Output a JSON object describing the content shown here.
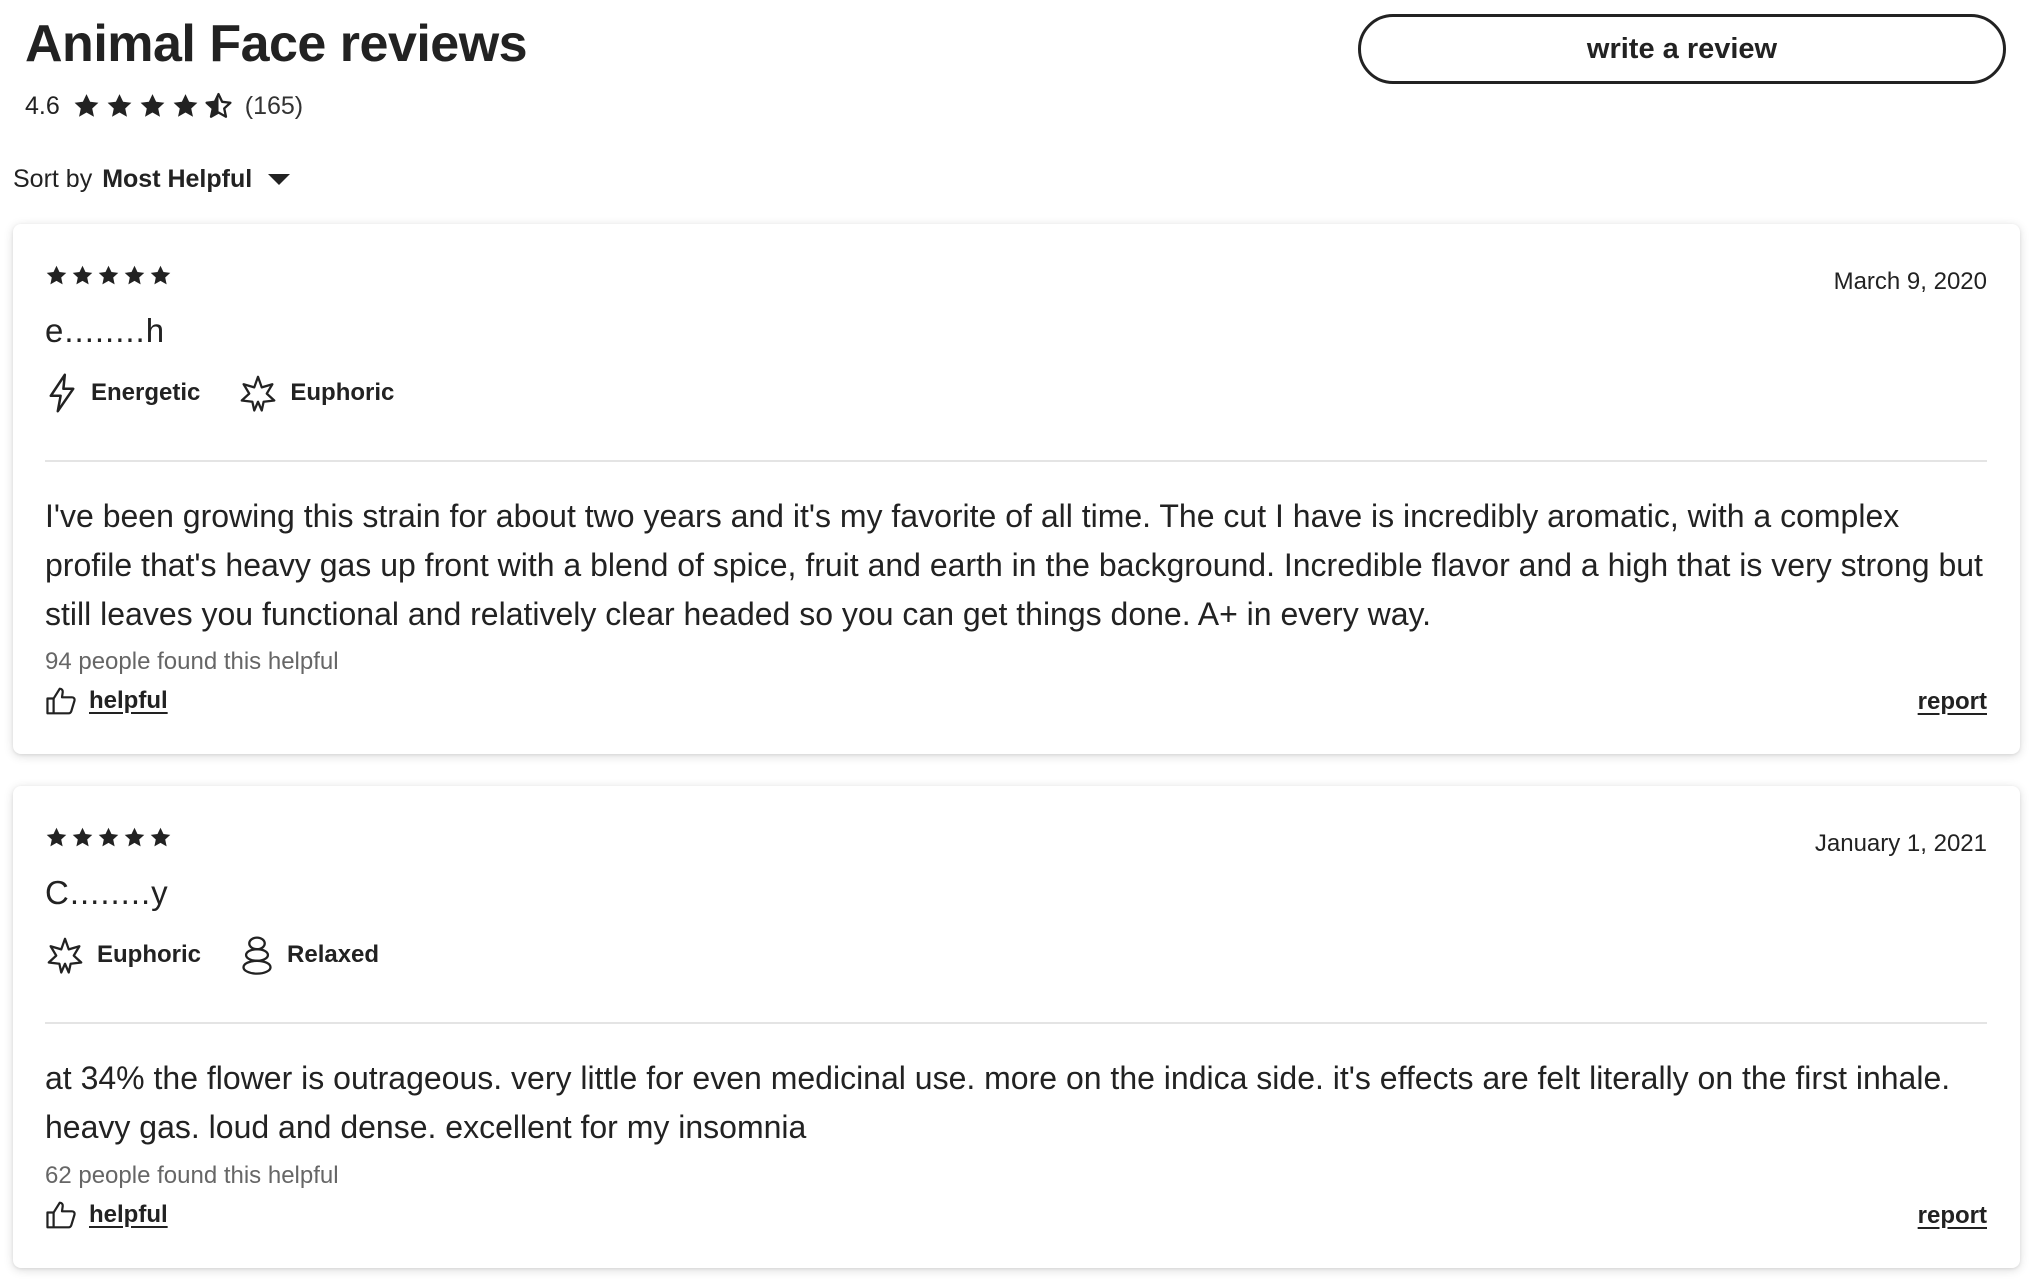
{
  "header": {
    "title": "Animal Face reviews",
    "rating": "4.6",
    "rating_value": 4.6,
    "review_count": "(165)",
    "write_review_label": "write a review"
  },
  "sort": {
    "label": "Sort by",
    "value": "Most Helpful"
  },
  "reviews": [
    {
      "stars": 5,
      "date": "March 9, 2020",
      "user": "e........h",
      "effects": [
        {
          "label": "Energetic",
          "icon": "lightning-icon"
        },
        {
          "label": "Euphoric",
          "icon": "burst-star-icon"
        }
      ],
      "body": "I've been growing this strain for about two years and it's my favorite of all time. The cut I have is incredibly aromatic, with a complex profile that's heavy gas up front with a blend of spice, fruit and earth in the background. Incredible flavor and a high that is very strong but still leaves you functional and relatively clear headed so you can get things done. A+ in every way.",
      "helpful_count": "94 people found this helpful",
      "helpful_label": "helpful",
      "report_label": "report"
    },
    {
      "stars": 5,
      "date": "January 1, 2021",
      "user": "C........y",
      "effects": [
        {
          "label": "Euphoric",
          "icon": "burst-star-icon"
        },
        {
          "label": "Relaxed",
          "icon": "stacked-stones-icon"
        }
      ],
      "body": "at 34% the flower is outrageous. very little for even medicinal use. more on the indica side. it's effects are felt literally on the first inhale. heavy gas. loud and dense. excellent for my insomnia",
      "helpful_count": "62 people found this helpful",
      "helpful_label": "helpful",
      "report_label": "report"
    }
  ],
  "colors": {
    "text": "#222222",
    "muted": "#666666",
    "divider": "#e4e4e4",
    "background": "#ffffff"
  }
}
